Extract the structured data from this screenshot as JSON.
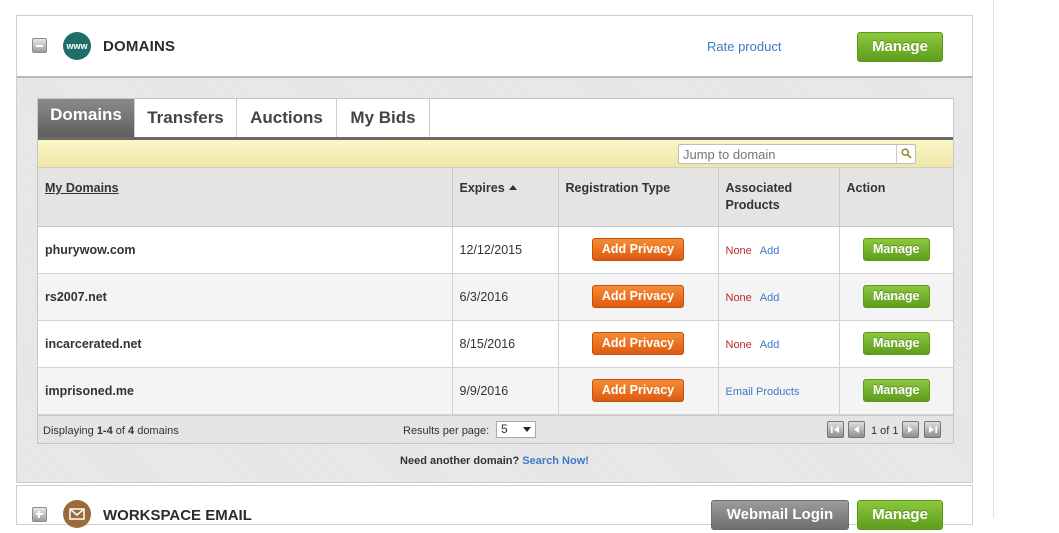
{
  "domains_panel": {
    "title": "DOMAINS",
    "icon_text": "www",
    "rate_link": "Rate product",
    "manage_label": "Manage"
  },
  "tabs": [
    {
      "label": "Domains",
      "active": true
    },
    {
      "label": "Transfers",
      "active": false
    },
    {
      "label": "Auctions",
      "active": false
    },
    {
      "label": "My Bids",
      "active": false
    }
  ],
  "search": {
    "placeholder": "Jump to domain"
  },
  "table": {
    "headers": {
      "domains": "My Domains",
      "expires": "Expires",
      "registration": "Registration Type",
      "associated": "Associated Products",
      "action": "Action"
    },
    "rows": [
      {
        "domain": "phurywow.com",
        "expires": "12/12/2015",
        "registration_button": "Add Privacy",
        "associated_none": "None",
        "associated_add": "Add",
        "action": "Manage"
      },
      {
        "domain": "rs2007.net",
        "expires": "6/3/2016",
        "registration_button": "Add Privacy",
        "associated_none": "None",
        "associated_add": "Add",
        "action": "Manage"
      },
      {
        "domain": "incarcerated.net",
        "expires": "8/15/2016",
        "registration_button": "Add Privacy",
        "associated_none": "None",
        "associated_add": "Add",
        "action": "Manage"
      },
      {
        "domain": "imprisoned.me",
        "expires": "9/9/2016",
        "registration_button": "Add Privacy",
        "associated_link": "Email Products",
        "action": "Manage"
      }
    ]
  },
  "footer": {
    "display_prefix": "Displaying ",
    "display_range": "1-4",
    "display_middle": " of ",
    "display_total": "4",
    "display_suffix": " domains",
    "results_per_page_label": "Results per page:",
    "results_per_page_value": "5",
    "page_info": "1 of 1"
  },
  "need_domain": {
    "text": "Need another domain?",
    "link": "Search Now!"
  },
  "email_panel": {
    "title": "WORKSPACE EMAIL",
    "webmail_label": "Webmail Login",
    "manage_label": "Manage"
  },
  "colors": {
    "accent_green": "#6aab24",
    "orange": "#ec7022",
    "link_blue": "#3f78c7",
    "none_red": "#c0262d"
  }
}
